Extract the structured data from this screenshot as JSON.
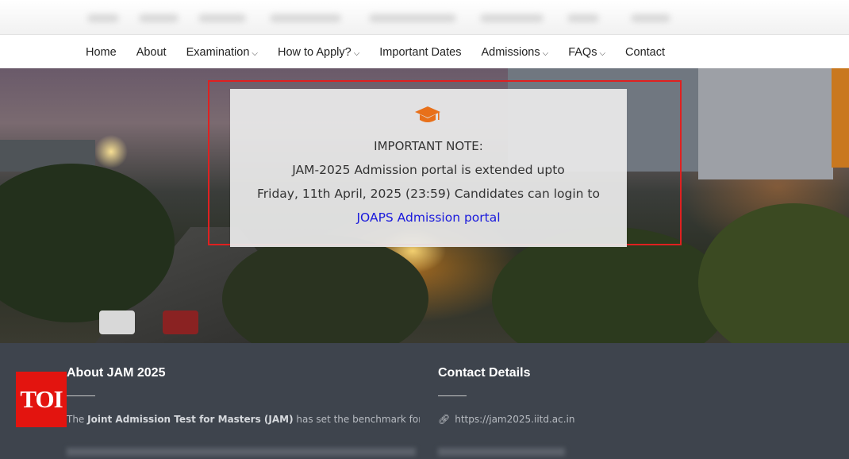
{
  "nav": {
    "items": [
      {
        "label": "Home",
        "dropdown": false
      },
      {
        "label": "About",
        "dropdown": false
      },
      {
        "label": "Examination",
        "dropdown": true
      },
      {
        "label": "How to Apply?",
        "dropdown": true
      },
      {
        "label": "Important Dates",
        "dropdown": false
      },
      {
        "label": "Admissions",
        "dropdown": true
      },
      {
        "label": "FAQs",
        "dropdown": true
      },
      {
        "label": "Contact",
        "dropdown": false
      }
    ],
    "caret": "⌵"
  },
  "notice": {
    "icon": "graduation-cap-icon",
    "icon_color": "#e8701a",
    "title": "IMPORTANT NOTE:",
    "line1": "JAM-2025 Admission portal is extended upto",
    "line2": "Friday, 11th April, 2025 (23:59) Candidates can login to",
    "link_text": "JOAPS Admission portal",
    "highlight_color": "#e02020"
  },
  "footer": {
    "about": {
      "heading": "About JAM 2025",
      "text_prefix": "The ",
      "text_bold": "Joint Admission Test for Masters (JAM)",
      "text_suffix": " has set the benchmark for"
    },
    "contact": {
      "heading": "Contact Details",
      "link_icon": "link-icon",
      "url": "https://jam2025.iitd.ac.in"
    }
  },
  "badge": {
    "text": "TOI",
    "color": "#e3140f"
  }
}
